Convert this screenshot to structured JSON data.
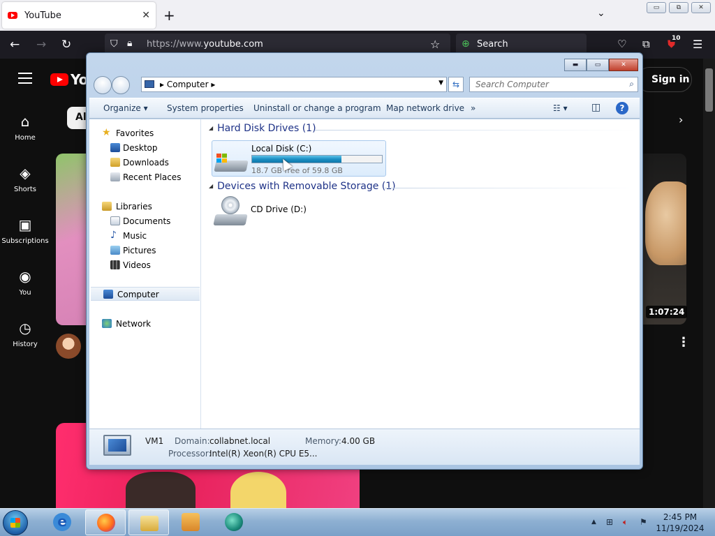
{
  "browser": {
    "tab_title": "YouTube",
    "tab_close": "✕",
    "new_tab": "+",
    "list_all_tabs": "⌄",
    "url_prefix": "https://www.",
    "url_host": "youtube.com",
    "search_label": "Search",
    "extension_badge": "10",
    "window_controls": {
      "minimize": "▭",
      "restore": "⧉",
      "close": "✕"
    }
  },
  "youtube": {
    "logo_text": "Yo",
    "sidebar": [
      {
        "label": "Home",
        "icon": "home-icon"
      },
      {
        "label": "Shorts",
        "icon": "shorts-icon"
      },
      {
        "label": "Subscriptions",
        "icon": "subscriptions-icon"
      },
      {
        "label": "You",
        "icon": "you-icon"
      },
      {
        "label": "History",
        "icon": "history-icon"
      }
    ],
    "chip_all": "Al",
    "sign_in": "Sign in",
    "video_duration": "1:07:24",
    "kebab": "⋮"
  },
  "explorer": {
    "window_controls": {
      "minimize": "▬",
      "maximize": "▭",
      "close": "✕"
    },
    "address": "Computer",
    "search_placeholder": "Search Computer",
    "commands": {
      "organize": "Organize ▾",
      "system_properties": "System properties",
      "uninstall": "Uninstall or change a program",
      "map_drive": "Map network drive",
      "more": "»"
    },
    "nav": {
      "favorites": "Favorites",
      "desktop": "Desktop",
      "downloads": "Downloads",
      "recent_places": "Recent Places",
      "libraries": "Libraries",
      "documents": "Documents",
      "music": "Music",
      "pictures": "Pictures",
      "videos": "Videos",
      "computer": "Computer",
      "network": "Network"
    },
    "groups": {
      "hard_disks": "Hard Disk Drives (1)",
      "removable": "Devices with Removable Storage (1)"
    },
    "drives": {
      "c": {
        "name": "Local Disk (C:)",
        "free_text": "18.7 GB free of 59.8 GB",
        "used_fraction": 0.69
      },
      "d": {
        "name": "CD Drive (D:)"
      }
    },
    "details": {
      "computer_name": "VM1",
      "domain_label": "Domain:",
      "domain_value": "collabnet.local",
      "memory_label": "Memory:",
      "memory_value": "4.00 GB",
      "processor_label": "Processor:",
      "processor_value": "Intel(R) Xeon(R) CPU E5..."
    }
  },
  "taskbar": {
    "clock_time": "2:45 PM",
    "clock_date": "11/19/2024",
    "tray_arrow": "▲"
  }
}
